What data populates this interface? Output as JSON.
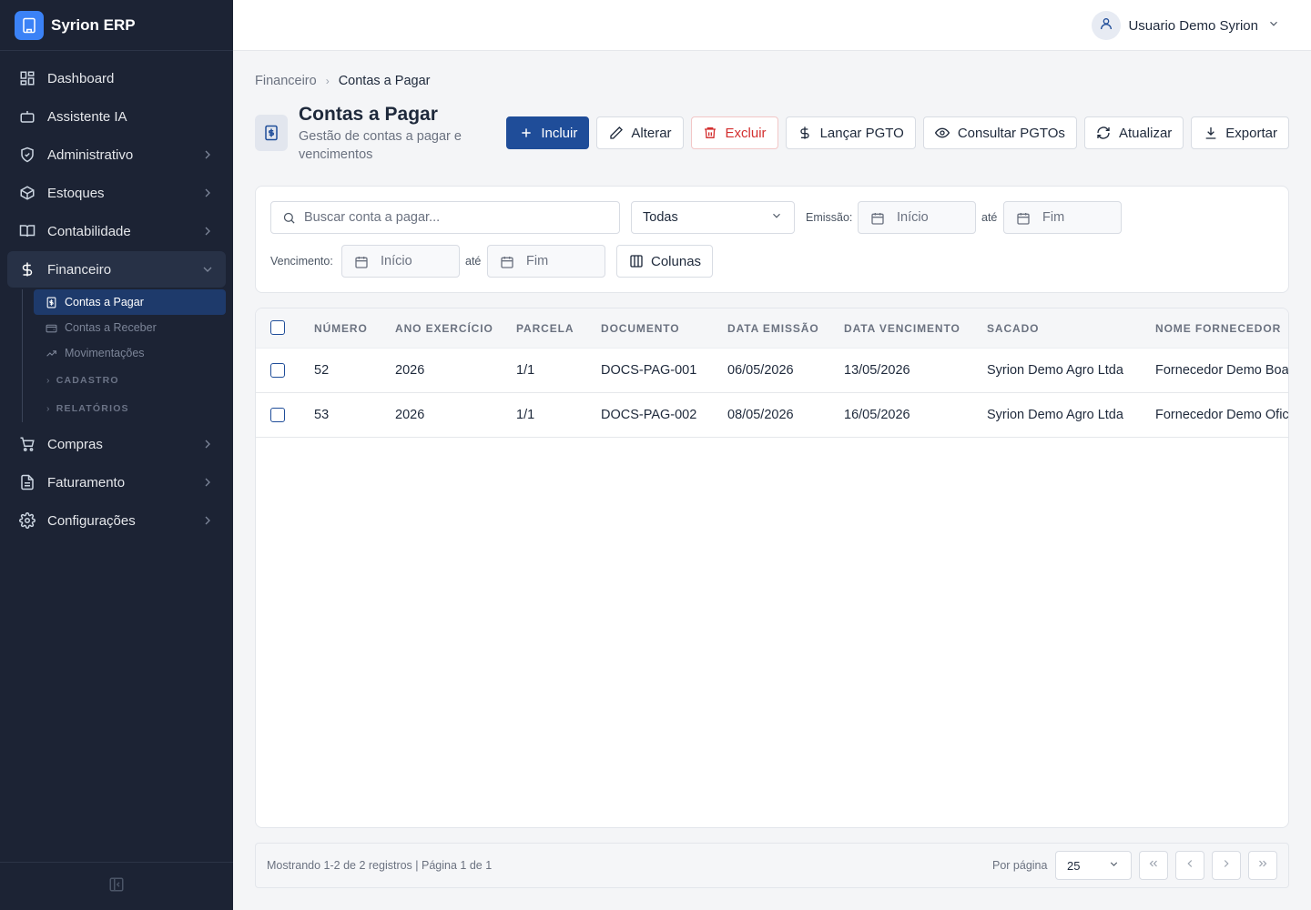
{
  "app": {
    "name": "Syrion ERP"
  },
  "sidebar": {
    "items": [
      {
        "label": "Dashboard",
        "icon": "dashboard-icon"
      },
      {
        "label": "Assistente IA",
        "icon": "bot-icon"
      },
      {
        "label": "Administrativo",
        "icon": "shield-icon"
      },
      {
        "label": "Estoques",
        "icon": "package-icon"
      },
      {
        "label": "Contabilidade",
        "icon": "book-icon"
      },
      {
        "label": "Financeiro",
        "icon": "dollar-icon"
      },
      {
        "label": "Compras",
        "icon": "cart-icon"
      },
      {
        "label": "Faturamento",
        "icon": "invoice-icon"
      },
      {
        "label": "Configurações",
        "icon": "gear-icon"
      }
    ],
    "financeiro_sub": [
      {
        "label": "Contas a Pagar"
      },
      {
        "label": "Contas a Receber"
      },
      {
        "label": "Movimentações"
      }
    ],
    "sections": [
      "CADASTRO",
      "RELATÓRIOS"
    ]
  },
  "topbar": {
    "user_name": "Usuario Demo Syrion"
  },
  "breadcrumb": {
    "parent": "Financeiro",
    "current": "Contas a Pagar"
  },
  "page": {
    "title": "Contas a Pagar",
    "subtitle": "Gestão de contas a pagar e vencimentos"
  },
  "toolbar": {
    "incluir": "Incluir",
    "alterar": "Alterar",
    "excluir": "Excluir",
    "lancar": "Lançar PGTO",
    "consultar": "Consultar PGTOs",
    "atualizar": "Atualizar",
    "exportar": "Exportar"
  },
  "filters": {
    "search_placeholder": "Buscar conta a pagar...",
    "status_value": "Todas",
    "emissao_label": "Emissão:",
    "vencimento_label": "Vencimento:",
    "ate": "até",
    "inicio": "Início",
    "fim": "Fim",
    "colunas": "Colunas"
  },
  "table": {
    "columns": [
      "Número",
      "Ano Exercício",
      "Parcela",
      "Documento",
      "Data Emissão",
      "Data Vencimento",
      "Sacado",
      "Nome Fornecedor"
    ],
    "rows": [
      {
        "numero": "52",
        "ano": "2026",
        "parcela": "1/1",
        "documento": "DOCS-PAG-001",
        "emissao": "06/05/2026",
        "vencimento": "13/05/2026",
        "sacado": "Syrion Demo Agro Ltda",
        "fornecedor": "Fornecedor Demo Boa"
      },
      {
        "numero": "53",
        "ano": "2026",
        "parcela": "1/1",
        "documento": "DOCS-PAG-002",
        "emissao": "08/05/2026",
        "vencimento": "16/05/2026",
        "sacado": "Syrion Demo Agro Ltda",
        "fornecedor": "Fornecedor Demo Ofic"
      }
    ]
  },
  "pager": {
    "info": "Mostrando 1-2 de 2 registros | Página 1 de 1",
    "per_page_label": "Por página",
    "per_page_value": "25"
  },
  "colors": {
    "sidebar_bg": "#1c2334",
    "primary": "#1f4d99",
    "danger": "#d32f2f"
  }
}
